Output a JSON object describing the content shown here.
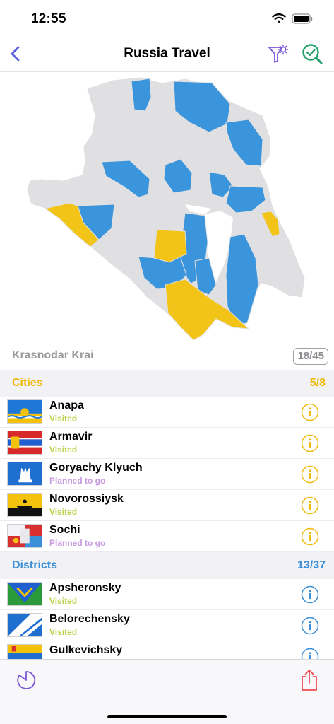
{
  "status_bar": {
    "time": "12:55"
  },
  "nav": {
    "title": "Russia Travel"
  },
  "region": {
    "name": "Krasnodar Krai",
    "count": "18/45"
  },
  "colors": {
    "visited_region": "#3a95dc",
    "planned_region": "#f2c418",
    "base_region": "#e0e0e2",
    "cities_accent": "#f0b90b",
    "districts_accent": "#3a8fd8",
    "visited_text": "#b6d34a",
    "planned_text": "#c79be0",
    "share_icon": "#ef4b50",
    "check_icon": "#22a06b",
    "filter_icon": "#7a55d6"
  },
  "cities": {
    "title": "Cities",
    "count": "5/8",
    "items": [
      {
        "name": "Anapa",
        "status": "Visited",
        "flag": "anapa-flag"
      },
      {
        "name": "Armavir",
        "status": "Visited",
        "flag": "armavir-flag"
      },
      {
        "name": "Goryachy Klyuch",
        "status": "Planned to go",
        "flag": "goryachy-klyuch-flag"
      },
      {
        "name": "Novorossiysk",
        "status": "Visited",
        "flag": "novorossiysk-flag"
      },
      {
        "name": "Sochi",
        "status": "Planned to go",
        "flag": "sochi-flag"
      }
    ]
  },
  "districts": {
    "title": "Districts",
    "count": "13/37",
    "items": [
      {
        "name": "Apsheronsky",
        "status": "Visited",
        "flag": "apsheronsky-flag"
      },
      {
        "name": "Belorechensky",
        "status": "Visited",
        "flag": "belorechensky-flag"
      },
      {
        "name": "Gulkevichsky",
        "status": "",
        "flag": "gulkevichsky-flag"
      }
    ]
  },
  "icons": {
    "back": "chevron-left-icon",
    "filter": "filter-gear-icon",
    "check": "magnifier-check-icon",
    "info": "info-icon",
    "rotate": "rotate-icon",
    "share": "share-icon"
  }
}
